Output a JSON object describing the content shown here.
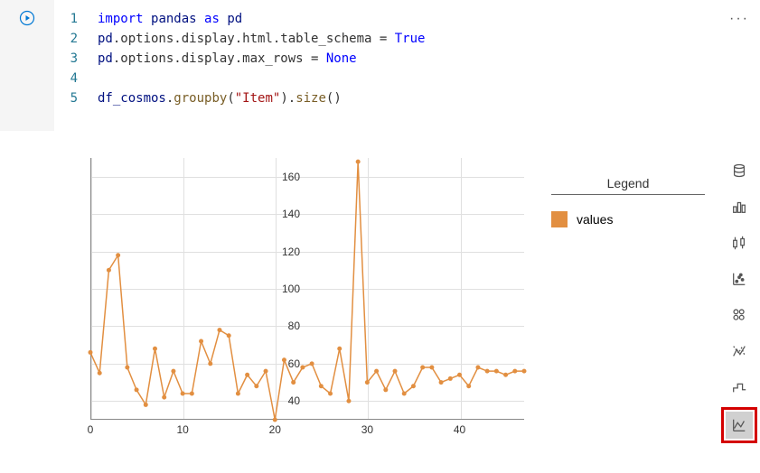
{
  "toolbar": {
    "more_glyph": "···"
  },
  "code": {
    "lines": [
      {
        "n": "1",
        "tokens": [
          [
            "kw-import",
            "import"
          ],
          [
            "",
            " "
          ],
          [
            "kw-ident",
            "pandas"
          ],
          [
            "",
            " "
          ],
          [
            "kw-as",
            "as"
          ],
          [
            "",
            " "
          ],
          [
            "kw-ident",
            "pd"
          ]
        ]
      },
      {
        "n": "2",
        "tokens": [
          [
            "kw-ident",
            "pd"
          ],
          [
            "",
            ".options.display.html.table_schema = "
          ],
          [
            "kw-true",
            "True"
          ]
        ]
      },
      {
        "n": "3",
        "tokens": [
          [
            "kw-ident",
            "pd"
          ],
          [
            "",
            ".options.display.max_rows = "
          ],
          [
            "kw-none",
            "None"
          ]
        ]
      },
      {
        "n": "4",
        "tokens": []
      },
      {
        "n": "5",
        "tokens": [
          [
            "kw-ident",
            "df_cosmos"
          ],
          [
            "",
            "."
          ],
          [
            "kw-func",
            "groupby"
          ],
          [
            "",
            "("
          ],
          [
            "kw-str",
            "\"Item\""
          ],
          [
            "",
            ")."
          ],
          [
            "kw-func",
            "size"
          ],
          [
            "",
            "()"
          ]
        ]
      }
    ]
  },
  "legend": {
    "title": "Legend",
    "series_label": "values"
  },
  "viz_buttons": [
    {
      "name": "data-table-icon"
    },
    {
      "name": "bar-chart-icon"
    },
    {
      "name": "box-plot-icon"
    },
    {
      "name": "scatter-plot-icon"
    },
    {
      "name": "hexbin-icon"
    },
    {
      "name": "sparkline-icon"
    },
    {
      "name": "step-chart-icon"
    },
    {
      "name": "line-chart-icon"
    }
  ],
  "chart_data": {
    "type": "line",
    "series": [
      {
        "name": "values",
        "color": "#e28f41",
        "x": [
          0,
          1,
          2,
          3,
          4,
          5,
          6,
          7,
          8,
          9,
          10,
          11,
          12,
          13,
          14,
          15,
          16,
          17,
          18,
          19,
          20,
          21,
          22,
          23,
          24,
          25,
          26,
          27,
          28,
          29,
          30,
          31,
          32,
          33,
          34,
          35,
          36,
          37,
          38,
          39,
          40,
          41,
          42,
          43,
          44,
          45,
          46,
          47
        ],
        "y": [
          66,
          55,
          110,
          118,
          58,
          46,
          38,
          68,
          42,
          56,
          44,
          44,
          72,
          60,
          78,
          75,
          44,
          54,
          48,
          56,
          30,
          62,
          50,
          58,
          60,
          48,
          44,
          68,
          40,
          168,
          50,
          56,
          46,
          56,
          44,
          48,
          58,
          58,
          50,
          52,
          54,
          48,
          58,
          56,
          56,
          54,
          56,
          56
        ]
      }
    ],
    "xlabel": "",
    "ylabel": "",
    "xlim": [
      0,
      47
    ],
    "ylim": [
      30,
      170
    ],
    "xticks": [
      0,
      10,
      20,
      30,
      40
    ],
    "yticks": [
      40,
      60,
      80,
      100,
      120,
      140,
      160
    ],
    "legend_title": "Legend",
    "grid": true
  }
}
